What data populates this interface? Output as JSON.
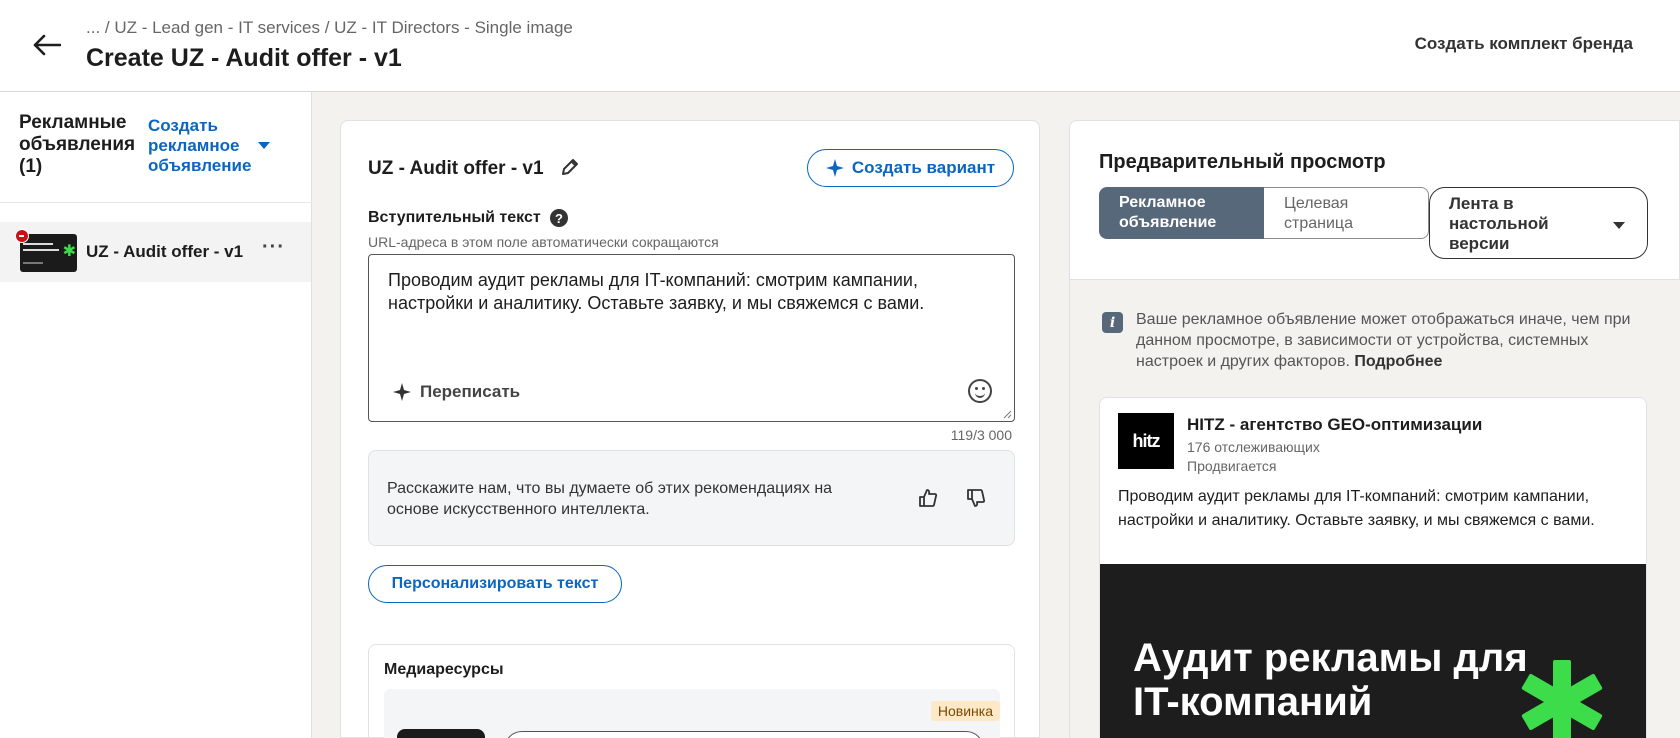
{
  "header": {
    "breadcrumb": "... / UZ - Lead gen - IT services / UZ - IT Directors - Single image",
    "title": "Create UZ - Audit offer - v1",
    "brand_kit_label": "Создать комплект бренда"
  },
  "sidebar": {
    "title": "Рекламные объявления (1)",
    "create_label": "Создать рекламное объявление",
    "items": [
      {
        "label": "UZ - Audit offer - v1"
      }
    ]
  },
  "editor": {
    "ad_name": "UZ - Audit offer - v1",
    "create_variant_label": "Создать вариант",
    "intro_label": "Вступительный текст",
    "url_note": "URL-адреса в этом поле автоматически сокращаются",
    "intro_text": "Проводим аудит рекламы для IT-компаний: смотрим кампании, настройки и аналитику. Оставьте заявку, и мы свяжемся с вами.",
    "rewrite_label": "Переписать",
    "char_counter": "119/3 000",
    "feedback_text": "Расскажите нам, что вы думаете об этих рекомендациях на основе искусственного интеллекта.",
    "personalize_label": "Персонализировать текст",
    "media_title": "Медиаресурсы",
    "new_badge": "Новинка"
  },
  "preview": {
    "title": "Предварительный просмотр",
    "tab_ad": "Рекламное объявление",
    "tab_landing": "Целевая страница",
    "feed_select": "Лента в настольной версии",
    "info_text": "Ваше рекламное объявление может отображаться иначе, чем при данном просмотре, в зависимости от устройства, системных настроек и других факторов.",
    "info_link": "Подробнее",
    "ad": {
      "logo_text": "hitz",
      "company": "HITZ - агентство GEO-оптимизации",
      "followers": "176 отслеживающих",
      "promoted": "Продвигается",
      "text": "Проводим аудит рекламы для IT-компаний: смотрим кампании, настройки и аналитику. Оставьте заявку, и мы свяжемся с вами.",
      "image_headline": "Аудит рекламы для IT-компаний"
    }
  },
  "colors": {
    "accent": "#0a66c2",
    "segment_active": "#56687a",
    "green_star": "#3ddc4a",
    "remove_red": "#cc1016"
  }
}
